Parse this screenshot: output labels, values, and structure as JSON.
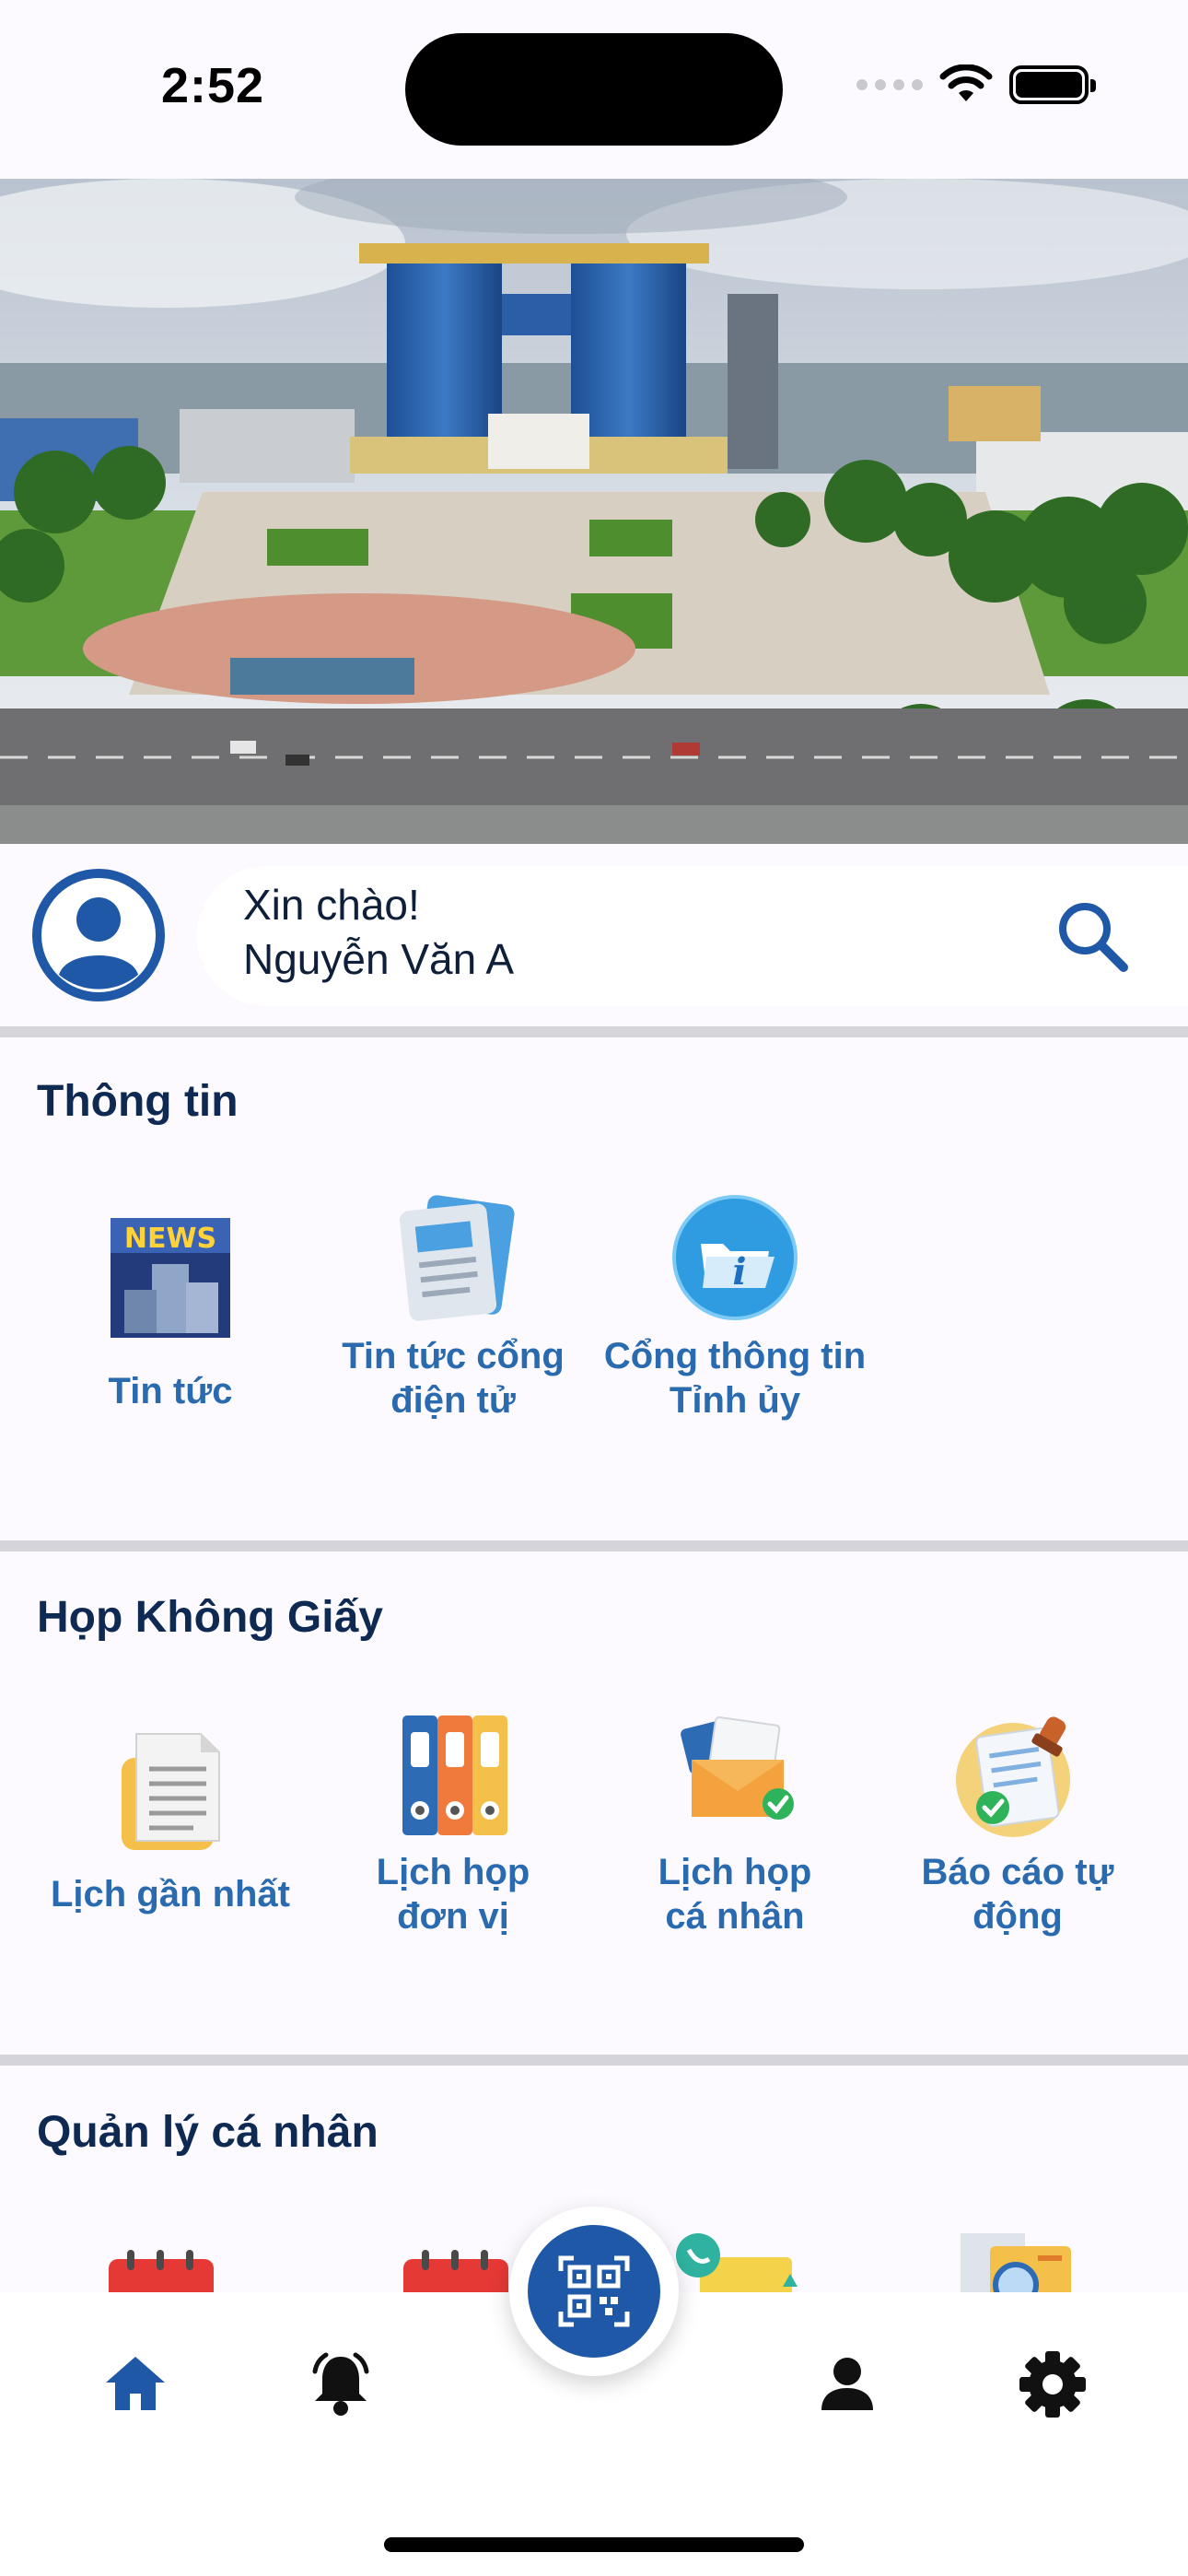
{
  "status_bar": {
    "time": "2:52"
  },
  "greeting": {
    "hello": "Xin chào!",
    "name": "Nguyễn Văn A"
  },
  "sections": {
    "info": {
      "title": "Thông tin",
      "items": [
        {
          "line1": "Tin tức",
          "line2": "",
          "icon": "news-icon"
        },
        {
          "line1": "Tin tức cổng",
          "line2": "điện tử",
          "icon": "newspaper-icon"
        },
        {
          "line1": "Cổng thông tin",
          "line2": "Tỉnh ủy",
          "icon": "info-folder-icon"
        }
      ]
    },
    "meeting": {
      "title": "Họp Không Giấy",
      "items": [
        {
          "line1": "Lịch gần nhất",
          "line2": "",
          "icon": "document-icon"
        },
        {
          "line1": "Lịch họp",
          "line2": "đơn vị",
          "icon": "binders-icon"
        },
        {
          "line1": "Lịch họp",
          "line2": "cá nhân",
          "icon": "envelope-check-icon"
        },
        {
          "line1": "Báo cáo tự",
          "line2": "động",
          "icon": "report-stamp-icon"
        }
      ]
    },
    "personal": {
      "title": "Quản lý cá nhân"
    }
  },
  "nav": {
    "active": "home",
    "items": [
      "home-icon",
      "bell-icon",
      "qr-code-icon",
      "user-icon",
      "settings-icon"
    ]
  },
  "colors": {
    "accent": "#1f58a6",
    "label": "#2a6bb0",
    "title": "#0f2a52"
  }
}
